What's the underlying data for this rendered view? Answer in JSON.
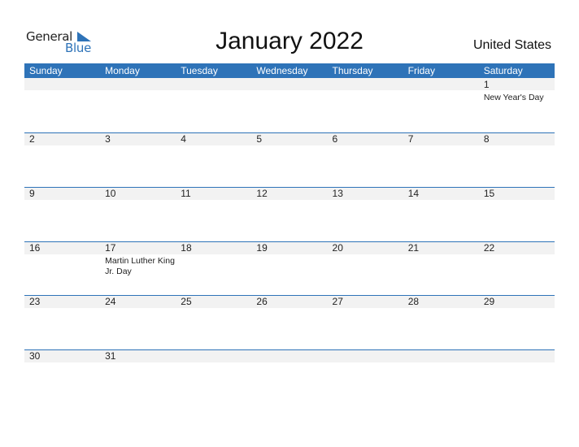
{
  "logo": {
    "word1": "General",
    "word2": "Blue"
  },
  "title": "January 2022",
  "country": "United States",
  "colors": {
    "accent": "#2e73b8",
    "strip": "#f2f2f2"
  },
  "weekdays": [
    "Sunday",
    "Monday",
    "Tuesday",
    "Wednesday",
    "Thursday",
    "Friday",
    "Saturday"
  ],
  "weeks": [
    [
      {
        "day": ""
      },
      {
        "day": ""
      },
      {
        "day": ""
      },
      {
        "day": ""
      },
      {
        "day": ""
      },
      {
        "day": ""
      },
      {
        "day": "1",
        "event": "New Year's Day"
      }
    ],
    [
      {
        "day": "2"
      },
      {
        "day": "3"
      },
      {
        "day": "4"
      },
      {
        "day": "5"
      },
      {
        "day": "6"
      },
      {
        "day": "7"
      },
      {
        "day": "8"
      }
    ],
    [
      {
        "day": "9"
      },
      {
        "day": "10"
      },
      {
        "day": "11"
      },
      {
        "day": "12"
      },
      {
        "day": "13"
      },
      {
        "day": "14"
      },
      {
        "day": "15"
      }
    ],
    [
      {
        "day": "16"
      },
      {
        "day": "17",
        "event": "Martin Luther King Jr. Day"
      },
      {
        "day": "18"
      },
      {
        "day": "19"
      },
      {
        "day": "20"
      },
      {
        "day": "21"
      },
      {
        "day": "22"
      }
    ],
    [
      {
        "day": "23"
      },
      {
        "day": "24"
      },
      {
        "day": "25"
      },
      {
        "day": "26"
      },
      {
        "day": "27"
      },
      {
        "day": "28"
      },
      {
        "day": "29"
      }
    ],
    [
      {
        "day": "30"
      },
      {
        "day": "31"
      },
      {
        "day": ""
      },
      {
        "day": ""
      },
      {
        "day": ""
      },
      {
        "day": ""
      },
      {
        "day": ""
      }
    ]
  ]
}
